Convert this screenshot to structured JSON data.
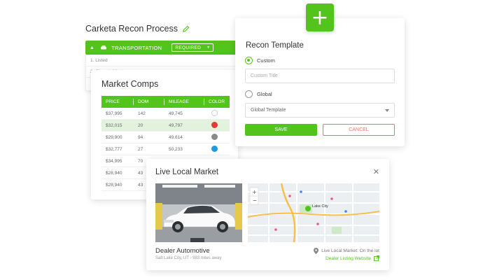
{
  "recon": {
    "title": "Carketa Recon Process",
    "stage_label": "TRANSPORTATION",
    "required_label": "REQUIRED",
    "list": [
      "1. Listed",
      "2. Chassis Mech..."
    ]
  },
  "comps": {
    "title": "Market Comps",
    "headers": [
      "PRICE",
      "DOM",
      "MILEAGE",
      "COLOR"
    ],
    "rows": [
      {
        "price": "$37,995",
        "dom": "142",
        "mileage": "49,745",
        "color": "#ffffff"
      },
      {
        "price": "$32,015",
        "dom": "20",
        "mileage": "49,797",
        "color": "#e53935"
      },
      {
        "price": "$29,900",
        "dom": "94",
        "mileage": "49,614",
        "color": "#8a8a8a"
      },
      {
        "price": "$32,777",
        "dom": "27",
        "mileage": "50,233",
        "color": "#1e9be0"
      },
      {
        "price": "$34,995",
        "dom": "70",
        "mileage": "",
        "color": ""
      },
      {
        "price": "$28,940",
        "dom": "43",
        "mileage": "",
        "color": ""
      },
      {
        "price": "$28,940",
        "dom": "43",
        "mileage": "",
        "color": ""
      }
    ]
  },
  "template": {
    "title": "Recon Template",
    "custom_label": "Custom",
    "custom_placeholder": "Custom Title",
    "global_label": "Global",
    "global_value": "Global Template",
    "save_label": "SAVE",
    "cancel_label": "CANCEL"
  },
  "market": {
    "title": "Live Local Market",
    "dealer_name": "Dealer Automotive",
    "dealer_location": "Salt Lake City, UT - 983 miles away",
    "status_text": "Live Local Market: On the lot",
    "listing_link": "Dealer Listing Website",
    "map_city_label": "Lake City"
  },
  "colors": {
    "accent": "#53c41b",
    "cancel": "#e57373"
  }
}
